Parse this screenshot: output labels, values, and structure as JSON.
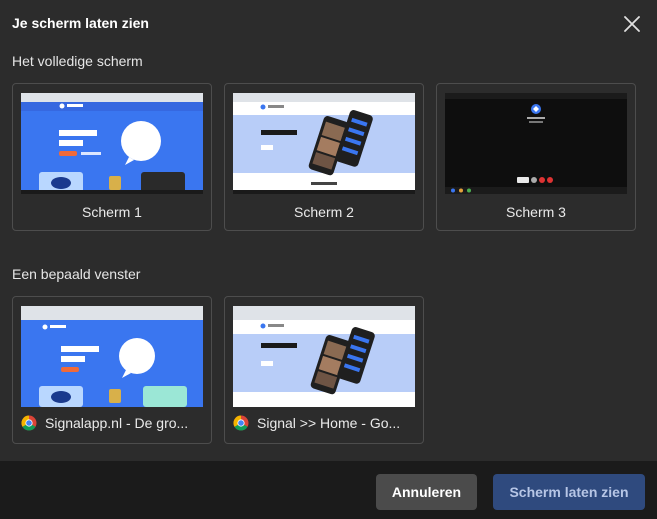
{
  "dialog": {
    "title": "Je scherm laten zien",
    "close_icon": "close-icon"
  },
  "screens": {
    "heading": "Het volledige scherm",
    "items": [
      {
        "label": "Scherm 1"
      },
      {
        "label": "Scherm 2"
      },
      {
        "label": "Scherm 3"
      }
    ]
  },
  "windows": {
    "heading": "Een bepaald venster",
    "items": [
      {
        "label": "Signalapp.nl - De gro...",
        "icon": "chrome-icon"
      },
      {
        "label": "Signal >> Home - Go...",
        "icon": "chrome-icon"
      }
    ]
  },
  "thumbnails": {
    "signal_download_heading": "Download Signal",
    "signal_home_heading": "Speak Freely"
  },
  "footer": {
    "cancel_label": "Annuleren",
    "share_label": "Scherm laten zien"
  },
  "colors": {
    "background": "#2c2c2c",
    "footer": "#1b1b1b",
    "primary_button": "#2f4a7e",
    "secondary_button": "#4b4b4b",
    "signal_blue": "#3a76f0"
  }
}
